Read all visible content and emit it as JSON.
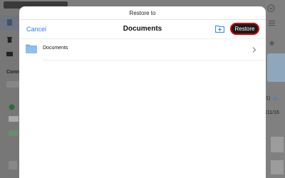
{
  "background_app": {
    "sidebar_heading": "Conn",
    "rating_label": "1)",
    "date_fragment": "/11/16"
  },
  "sheet": {
    "title": "Restore to",
    "cancel_label": "Cancel",
    "location_title": "Documents",
    "restore_label": "Restore",
    "icons": {
      "new_folder": "folder-add-icon",
      "folder": "folder-icon",
      "chevron": "chevron-right-icon"
    },
    "folders": [
      {
        "label": "Documents"
      }
    ]
  },
  "colors": {
    "accent": "#2f7cf6",
    "restore_outline": "#d40000",
    "restore_fill": "#1a1a1a",
    "folder": "#7fb2ea"
  }
}
